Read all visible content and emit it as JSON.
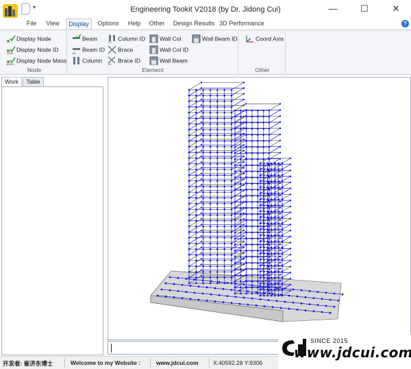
{
  "window": {
    "title": "Engineering Tookit V2018 (by Dr. Jidong Cui)",
    "qa_glyph": "▾"
  },
  "controls": {
    "minimize": "—",
    "maximize": "☐",
    "close": "✕"
  },
  "menu": {
    "tabs": [
      {
        "label": "File",
        "active": false
      },
      {
        "label": "View",
        "active": false
      },
      {
        "label": "Display",
        "active": true
      },
      {
        "label": "Options",
        "active": false
      },
      {
        "label": "Help",
        "active": false
      },
      {
        "label": "Other",
        "active": false
      },
      {
        "label": "Design Results",
        "active": false
      },
      {
        "label": "3D Performance",
        "active": false
      }
    ],
    "help_glyph": "?"
  },
  "ribbon": {
    "node": {
      "label": "Node",
      "buttons": [
        {
          "label": "Display Node",
          "icon": "node-dot-check-icon"
        },
        {
          "label": "Display Node ID",
          "icon": "node-id-check-icon"
        },
        {
          "label": "Display Node Mass",
          "icon": "node-mass-check-icon"
        }
      ]
    },
    "element": {
      "label": "Element",
      "buttons": [
        {
          "label": "Beam",
          "icon": "beam-icon"
        },
        {
          "label": "Beam ID",
          "icon": "beam-id-icon"
        },
        {
          "label": "Column",
          "icon": "column-icon"
        },
        {
          "label": "Column ID",
          "icon": "column-id-icon"
        },
        {
          "label": "Brace",
          "icon": "brace-icon"
        },
        {
          "label": "Brace ID",
          "icon": "brace-id-icon"
        },
        {
          "label": "Wall Col",
          "icon": "wall-col-icon"
        },
        {
          "label": "Wall Col ID",
          "icon": "wall-col-id-icon"
        },
        {
          "label": "Wall Beam",
          "icon": "wall-beam-icon"
        },
        {
          "label": "Wall Beam ID",
          "icon": "wall-beam-id-icon"
        }
      ]
    },
    "other": {
      "label": "Other",
      "buttons": [
        {
          "label": "Coord Axis",
          "icon": "coord-axis-icon"
        }
      ]
    }
  },
  "left_panel": {
    "tabs": [
      "Work",
      "Table"
    ],
    "active_tab": "Work"
  },
  "viewport": {
    "model_color": "#1010ee",
    "frame_color": "#555555",
    "slab_color": "#d8d8d8"
  },
  "status": {
    "publisher": "开发者: 崔济东博士",
    "welcome": "Welcome to my Website :",
    "website": "www.jdcui.com",
    "coords": "X:40592.28 Y:9306"
  },
  "watermark": {
    "logo": "Cd",
    "since": "SINCE 2015",
    "url": "www.jdcui.com"
  }
}
